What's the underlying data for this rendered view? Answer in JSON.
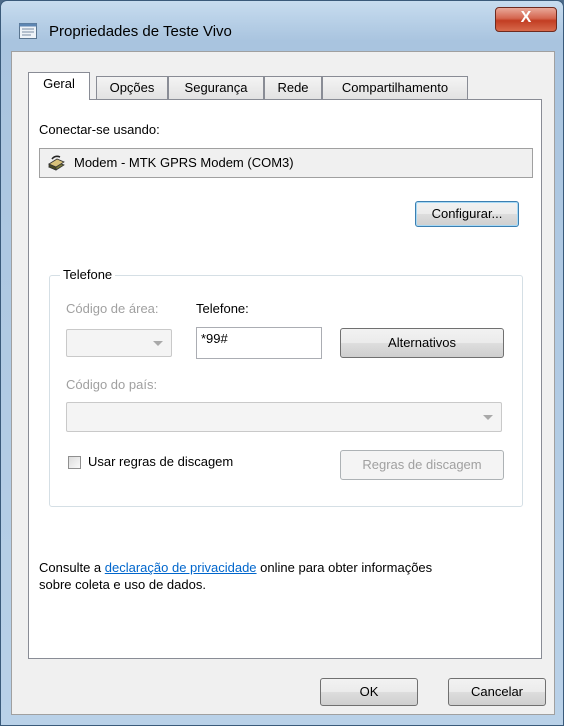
{
  "window": {
    "title": "Propriedades de Teste Vivo",
    "close_label": "X"
  },
  "tabs": [
    {
      "label": "Geral",
      "active": true
    },
    {
      "label": "Opções",
      "active": false
    },
    {
      "label": "Segurança",
      "active": false
    },
    {
      "label": "Rede",
      "active": false
    },
    {
      "label": "Compartilhamento",
      "active": false
    }
  ],
  "general": {
    "connect_using_label": "Conectar-se usando:",
    "device_name": "Modem - MTK GPRS Modem (COM3)",
    "configure_button": "Configurar...",
    "phone_group": {
      "legend": "Telefone",
      "area_code_label": "Código de área:",
      "area_code_value": "",
      "phone_label": "Telefone:",
      "phone_value": "*99#",
      "alternates_button": "Alternativos",
      "country_code_label": "Código do país:",
      "country_code_value": "",
      "use_dialing_rules_label": "Usar regras de discagem",
      "use_dialing_rules_checked": false,
      "dialing_rules_button": "Regras de discagem"
    },
    "privacy": {
      "prefix": "Consulte a ",
      "link": "declaração de privacidade",
      "suffix": " online para obter informações",
      "line2": "sobre coleta e uso de dados."
    }
  },
  "footer": {
    "ok_button": "OK",
    "cancel_button": "Cancelar"
  },
  "colors": {
    "link": "#0066cc",
    "disabled_text": "#a0a0a0",
    "close_button": "#c23d22"
  }
}
